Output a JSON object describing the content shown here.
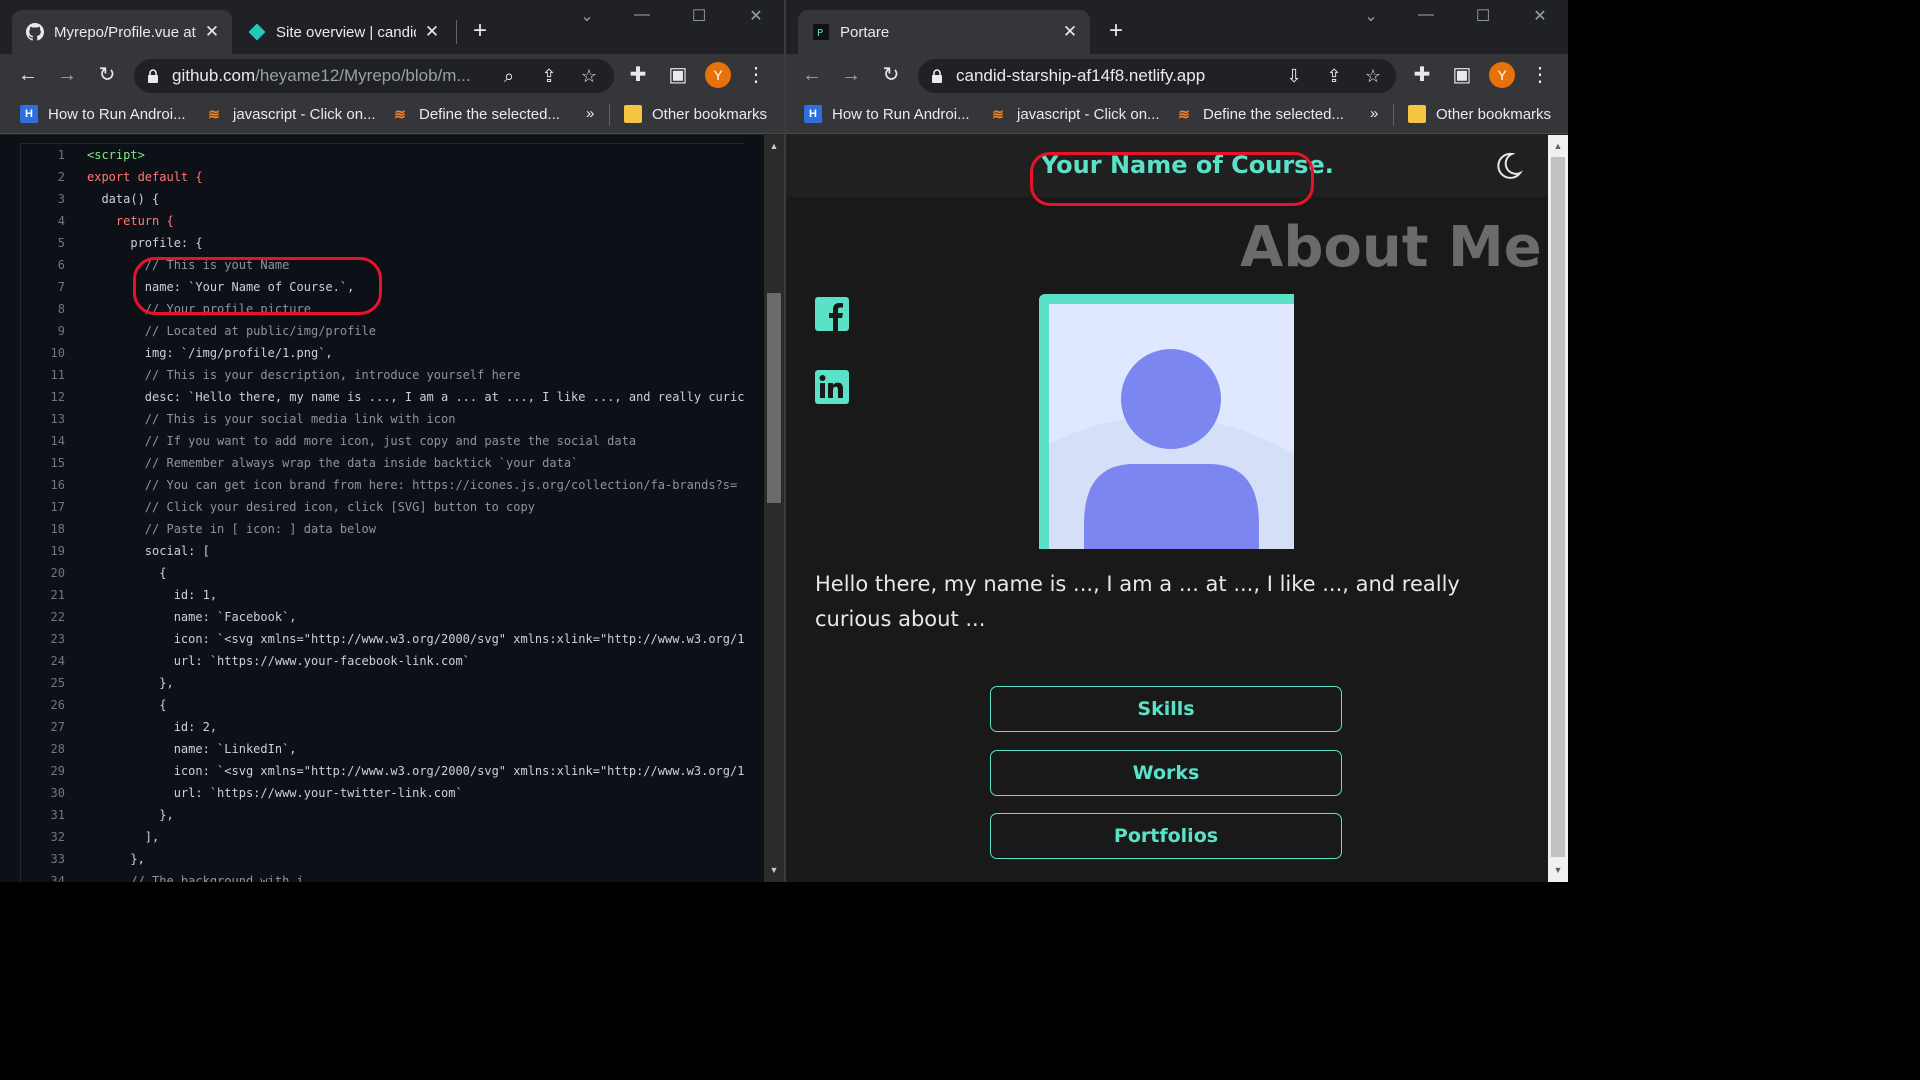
{
  "left_window": {
    "tabs": [
      {
        "title": "Myrepo/Profile.vue at",
        "active": true,
        "icon": "github-icon"
      },
      {
        "title": "Site overview | candid",
        "active": false,
        "icon": "netlify-icon"
      }
    ],
    "address": {
      "host": "github.com",
      "path": "/heyame12/Myrepo/blob/m..."
    },
    "code": {
      "lines": [
        {
          "n": "1",
          "text": "<script>"
        },
        {
          "n": "2",
          "text": "export default {"
        },
        {
          "n": "3",
          "text": "  data() {"
        },
        {
          "n": "4",
          "text": "    return {"
        },
        {
          "n": "5",
          "text": "      profile: {"
        },
        {
          "n": "6",
          "text": "        // This is yout Name"
        },
        {
          "n": "7",
          "text": "        name: `Your Name of Course.`,"
        },
        {
          "n": "8",
          "text": "        // Your profile picture"
        },
        {
          "n": "9",
          "text": "        // Located at public/img/profile"
        },
        {
          "n": "10",
          "text": "        img: `/img/profile/1.png`,"
        },
        {
          "n": "11",
          "text": "        // This is your description, introduce yourself here"
        },
        {
          "n": "12",
          "text": "        desc: `Hello there, my name is ..., I am a ... at ..., I like ..., and really curic"
        },
        {
          "n": "13",
          "text": "        // This is your social media link with icon"
        },
        {
          "n": "14",
          "text": "        // If you want to add more icon, just copy and paste the social data"
        },
        {
          "n": "15",
          "text": "        // Remember always wrap the data inside backtick `your data`"
        },
        {
          "n": "16",
          "text": "        // You can get icon brand from here: https://icones.js.org/collection/fa-brands?s="
        },
        {
          "n": "17",
          "text": "        // Click your desired icon, click [SVG] button to copy"
        },
        {
          "n": "18",
          "text": "        // Paste in [ icon: ] data below"
        },
        {
          "n": "19",
          "text": "        social: ["
        },
        {
          "n": "20",
          "text": "          {"
        },
        {
          "n": "21",
          "text": "            id: 1,"
        },
        {
          "n": "22",
          "text": "            name: `Facebook`,"
        },
        {
          "n": "23",
          "text": "            icon: `<svg xmlns=\"http://www.w3.org/2000/svg\" xmlns:xlink=\"http://www.w3.org/1"
        },
        {
          "n": "24",
          "text": "            url: `https://www.your-facebook-link.com`"
        },
        {
          "n": "25",
          "text": "          },"
        },
        {
          "n": "26",
          "text": "          {"
        },
        {
          "n": "27",
          "text": "            id: 2,"
        },
        {
          "n": "28",
          "text": "            name: `LinkedIn`,"
        },
        {
          "n": "29",
          "text": "            icon: `<svg xmlns=\"http://www.w3.org/2000/svg\" xmlns:xlink=\"http://www.w3.org/1"
        },
        {
          "n": "30",
          "text": "            url: `https://www.your-twitter-link.com`"
        },
        {
          "n": "31",
          "text": "          },"
        },
        {
          "n": "32",
          "text": "        ],"
        },
        {
          "n": "33",
          "text": "      },"
        },
        {
          "n": "34",
          "text": "      // The background with i"
        }
      ]
    }
  },
  "right_window": {
    "tabs": [
      {
        "title": "Portare",
        "active": true,
        "icon": "portare-icon"
      }
    ],
    "address": {
      "host": "candid-starship-af14f8.netlify.app"
    },
    "site": {
      "header_title": "Your Name of Course.",
      "theme_toggle_icon": "moon-icon",
      "about_heading": "About Me",
      "social": [
        {
          "name": "Facebook",
          "icon": "facebook-icon"
        },
        {
          "name": "LinkedIn",
          "icon": "linkedin-icon"
        }
      ],
      "description": "Hello there, my name is ..., I am a ... at ..., I like ..., and really curious about ...",
      "buttons": [
        {
          "label": "Skills"
        },
        {
          "label": "Works"
        },
        {
          "label": "Portfolios"
        }
      ]
    }
  },
  "bookmarks": [
    {
      "label": "How to Run Androi...",
      "icon": "h-icon"
    },
    {
      "label": "javascript - Click on...",
      "icon": "stackoverflow-icon"
    },
    {
      "label": "Define the selected...",
      "icon": "stackoverflow-icon"
    }
  ],
  "bookmarks_overflow": "»",
  "other_bookmarks": "Other bookmarks",
  "avatar_letter": "Y",
  "colors": {
    "accent_teal": "#5ce1c9",
    "annotation_red": "#e8122b",
    "code_bg": "#0d1117",
    "site_bg": "#191919",
    "avatar_orange": "#e8710a",
    "placeholder_purple": "#7b86f0"
  }
}
